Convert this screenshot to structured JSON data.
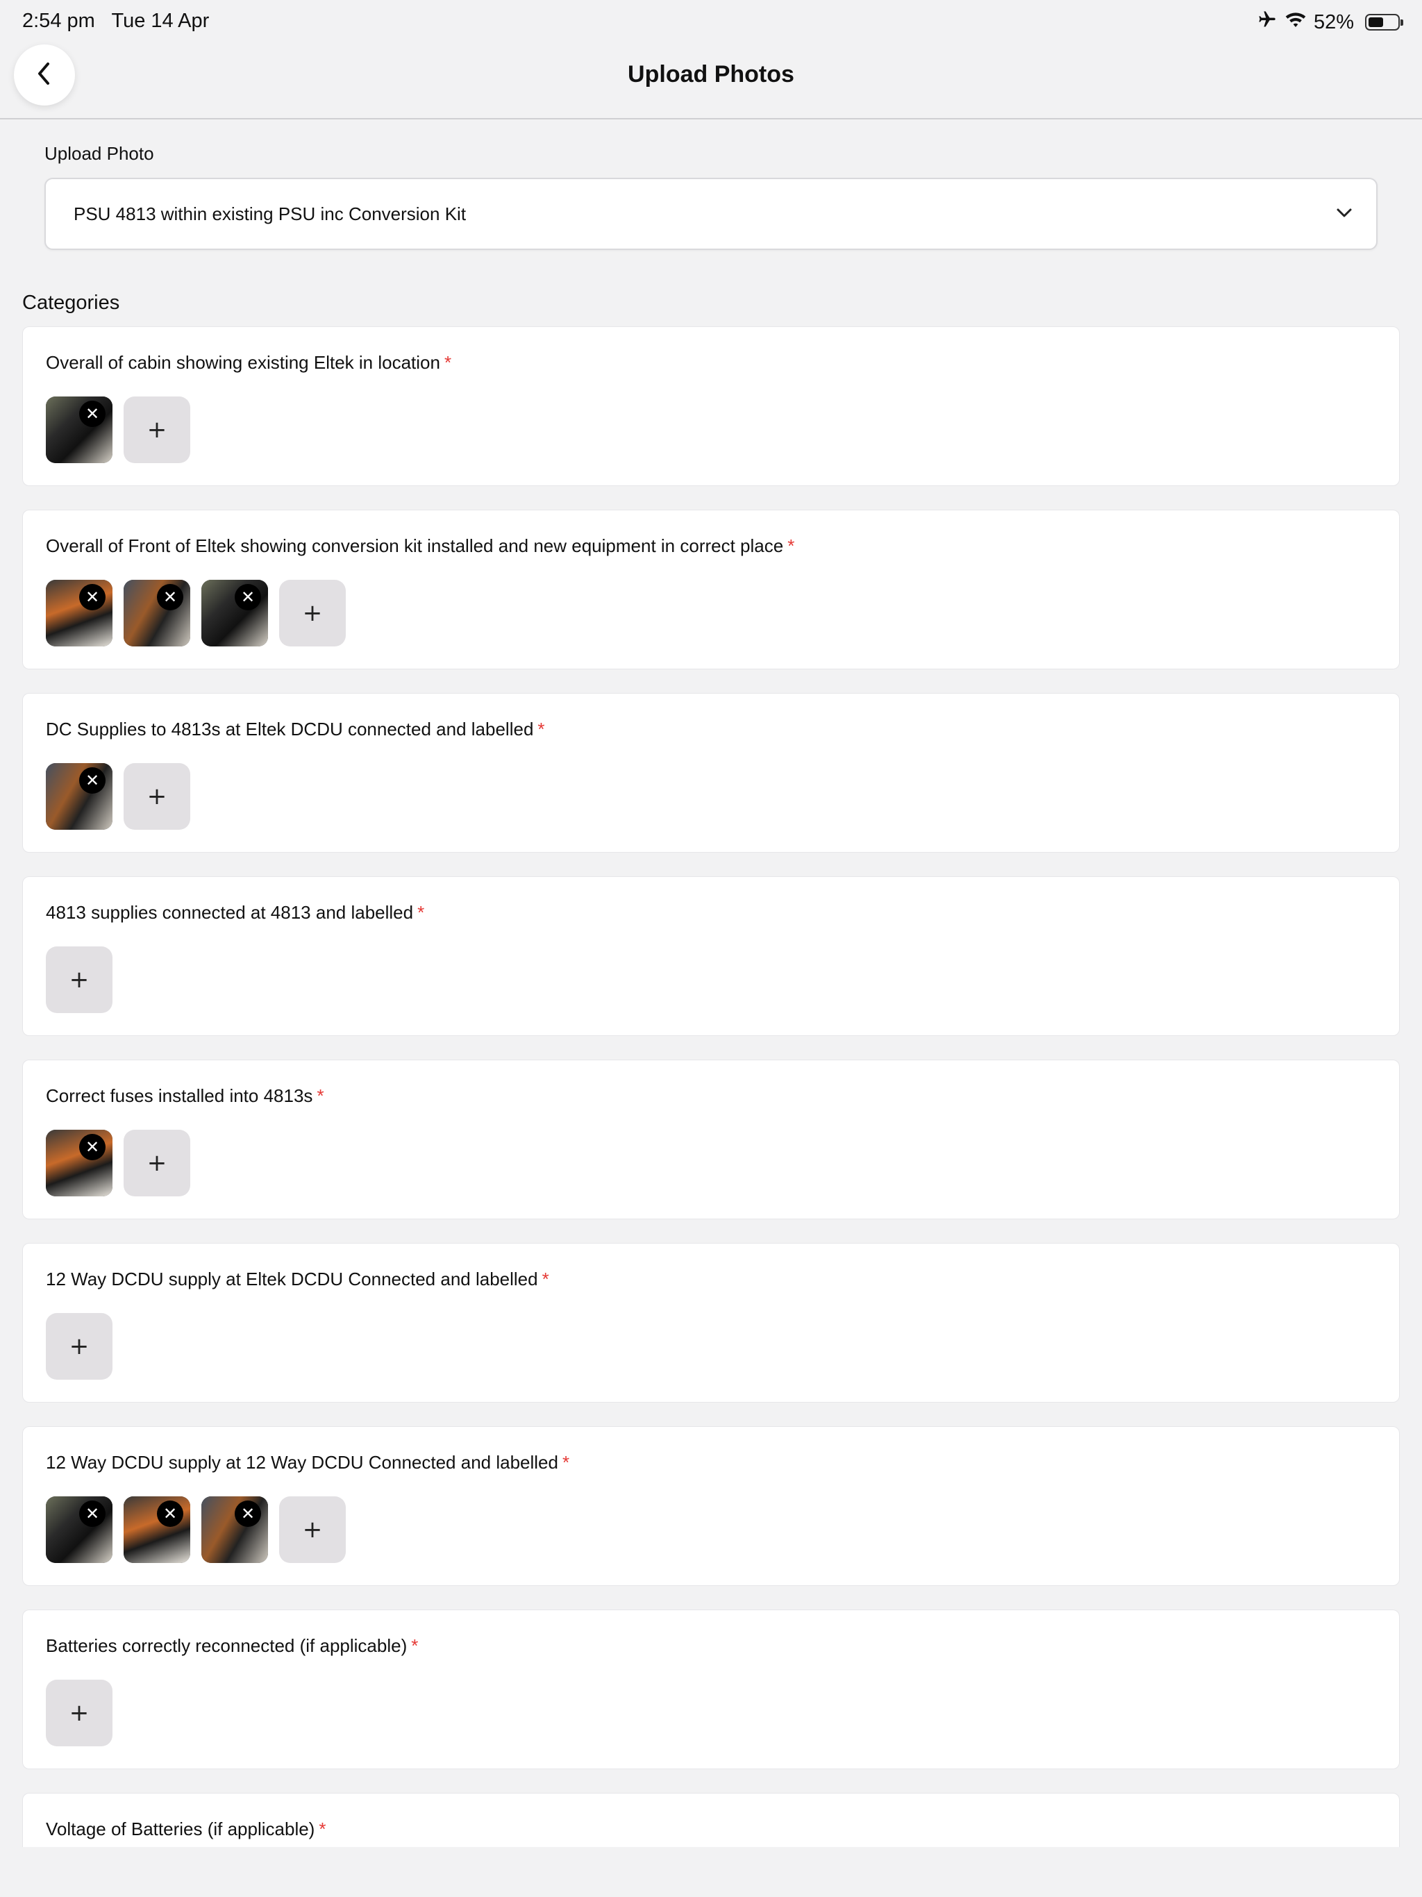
{
  "status": {
    "time": "2:54 pm",
    "date": "Tue 14 Apr",
    "battery": "52%",
    "battery_level": 0.52
  },
  "nav": {
    "title": "Upload Photos",
    "back_icon": "chevron-left-icon"
  },
  "upload": {
    "label": "Upload Photo",
    "selected": "PSU 4813 within existing PSU inc Conversion Kit"
  },
  "categories_heading": "Categories",
  "add_symbol": "+",
  "remove_symbol": "✕",
  "required_marker": "*",
  "categories": [
    {
      "title": "Overall of cabin showing existing Eltek in location",
      "photos": 1
    },
    {
      "title": "Overall of Front of Eltek showing conversion kit installed and new equipment in correct place",
      "photos": 3
    },
    {
      "title": "DC Supplies to 4813s at Eltek DCDU connected and labelled",
      "photos": 1
    },
    {
      "title": "4813 supplies connected at 4813 and labelled",
      "photos": 0
    },
    {
      "title": "Correct fuses installed into 4813s",
      "photos": 1
    },
    {
      "title": "12 Way DCDU supply at Eltek DCDU Connected and labelled",
      "photos": 0
    },
    {
      "title": "12 Way DCDU supply at 12 Way DCDU Connected and labelled",
      "photos": 3
    },
    {
      "title": "Batteries correctly reconnected (if applicable)",
      "photos": 0
    },
    {
      "title": "Voltage of Batteries (if applicable)",
      "photos": 0
    }
  ]
}
